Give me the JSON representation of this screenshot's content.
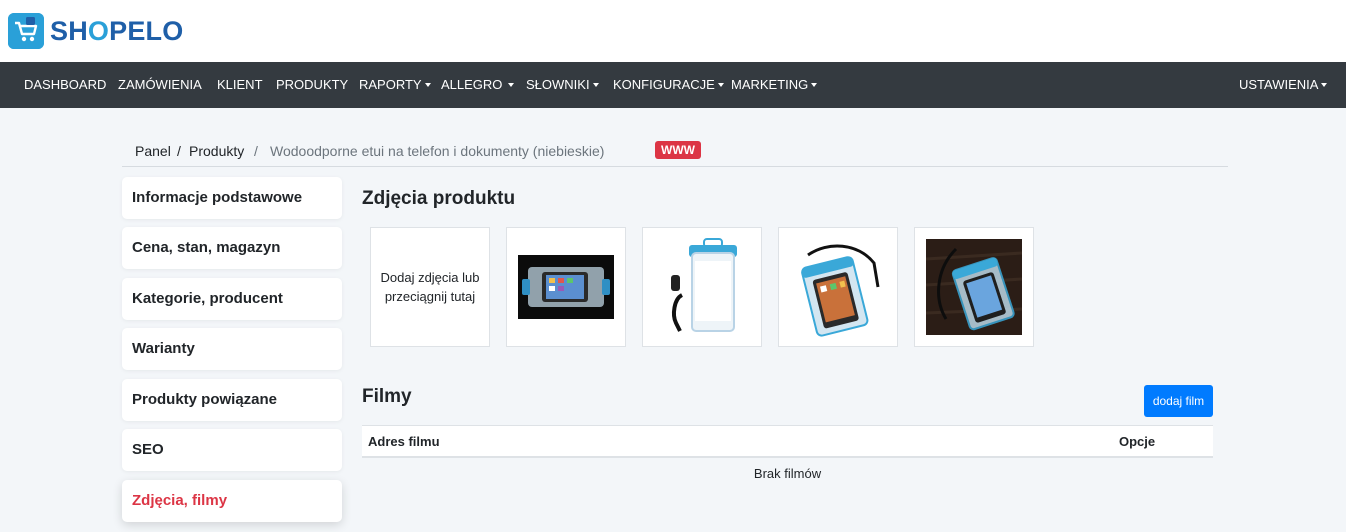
{
  "brand": {
    "name_prefix": "SH",
    "name_o": "O",
    "name_suffix": "PELO"
  },
  "nav": {
    "dashboard": "DASHBOARD",
    "orders": "ZAMÓWIENIA",
    "client": "KLIENT",
    "products": "PRODUKTY",
    "reports": "RAPORTY",
    "allegro": "ALLEGRO",
    "dictionaries": "SŁOWNIKI",
    "configuration": "KONFIGURACJE",
    "marketing": "MARKETING",
    "settings": "USTAWIENIA"
  },
  "breadcrumb": {
    "panel": "Panel",
    "sep": "/",
    "products": "Produkty",
    "current": "Wodoodporne etui na telefon i dokumenty (niebieskie)",
    "badge": "WWW"
  },
  "sidebar": {
    "items": [
      "Informacje podstawowe",
      "Cena, stan, magazyn",
      "Kategorie, producent",
      "Warianty",
      "Produkty powiązane",
      "SEO",
      "Zdjęcia, filmy"
    ]
  },
  "photos": {
    "title": "Zdjęcia produktu",
    "dropzone": "Dodaj zdjęcia lub przeciągnij tutaj"
  },
  "films": {
    "title": "Filmy",
    "add_button": "dodaj film",
    "col_address": "Adres filmu",
    "col_options": "Opcje",
    "empty": "Brak filmów"
  },
  "colors": {
    "nav_bg": "#343a40",
    "accent": "#007bff",
    "danger": "#dc3545",
    "brand_blue": "#1f5fa8",
    "brand_light": "#2aa0d8"
  }
}
